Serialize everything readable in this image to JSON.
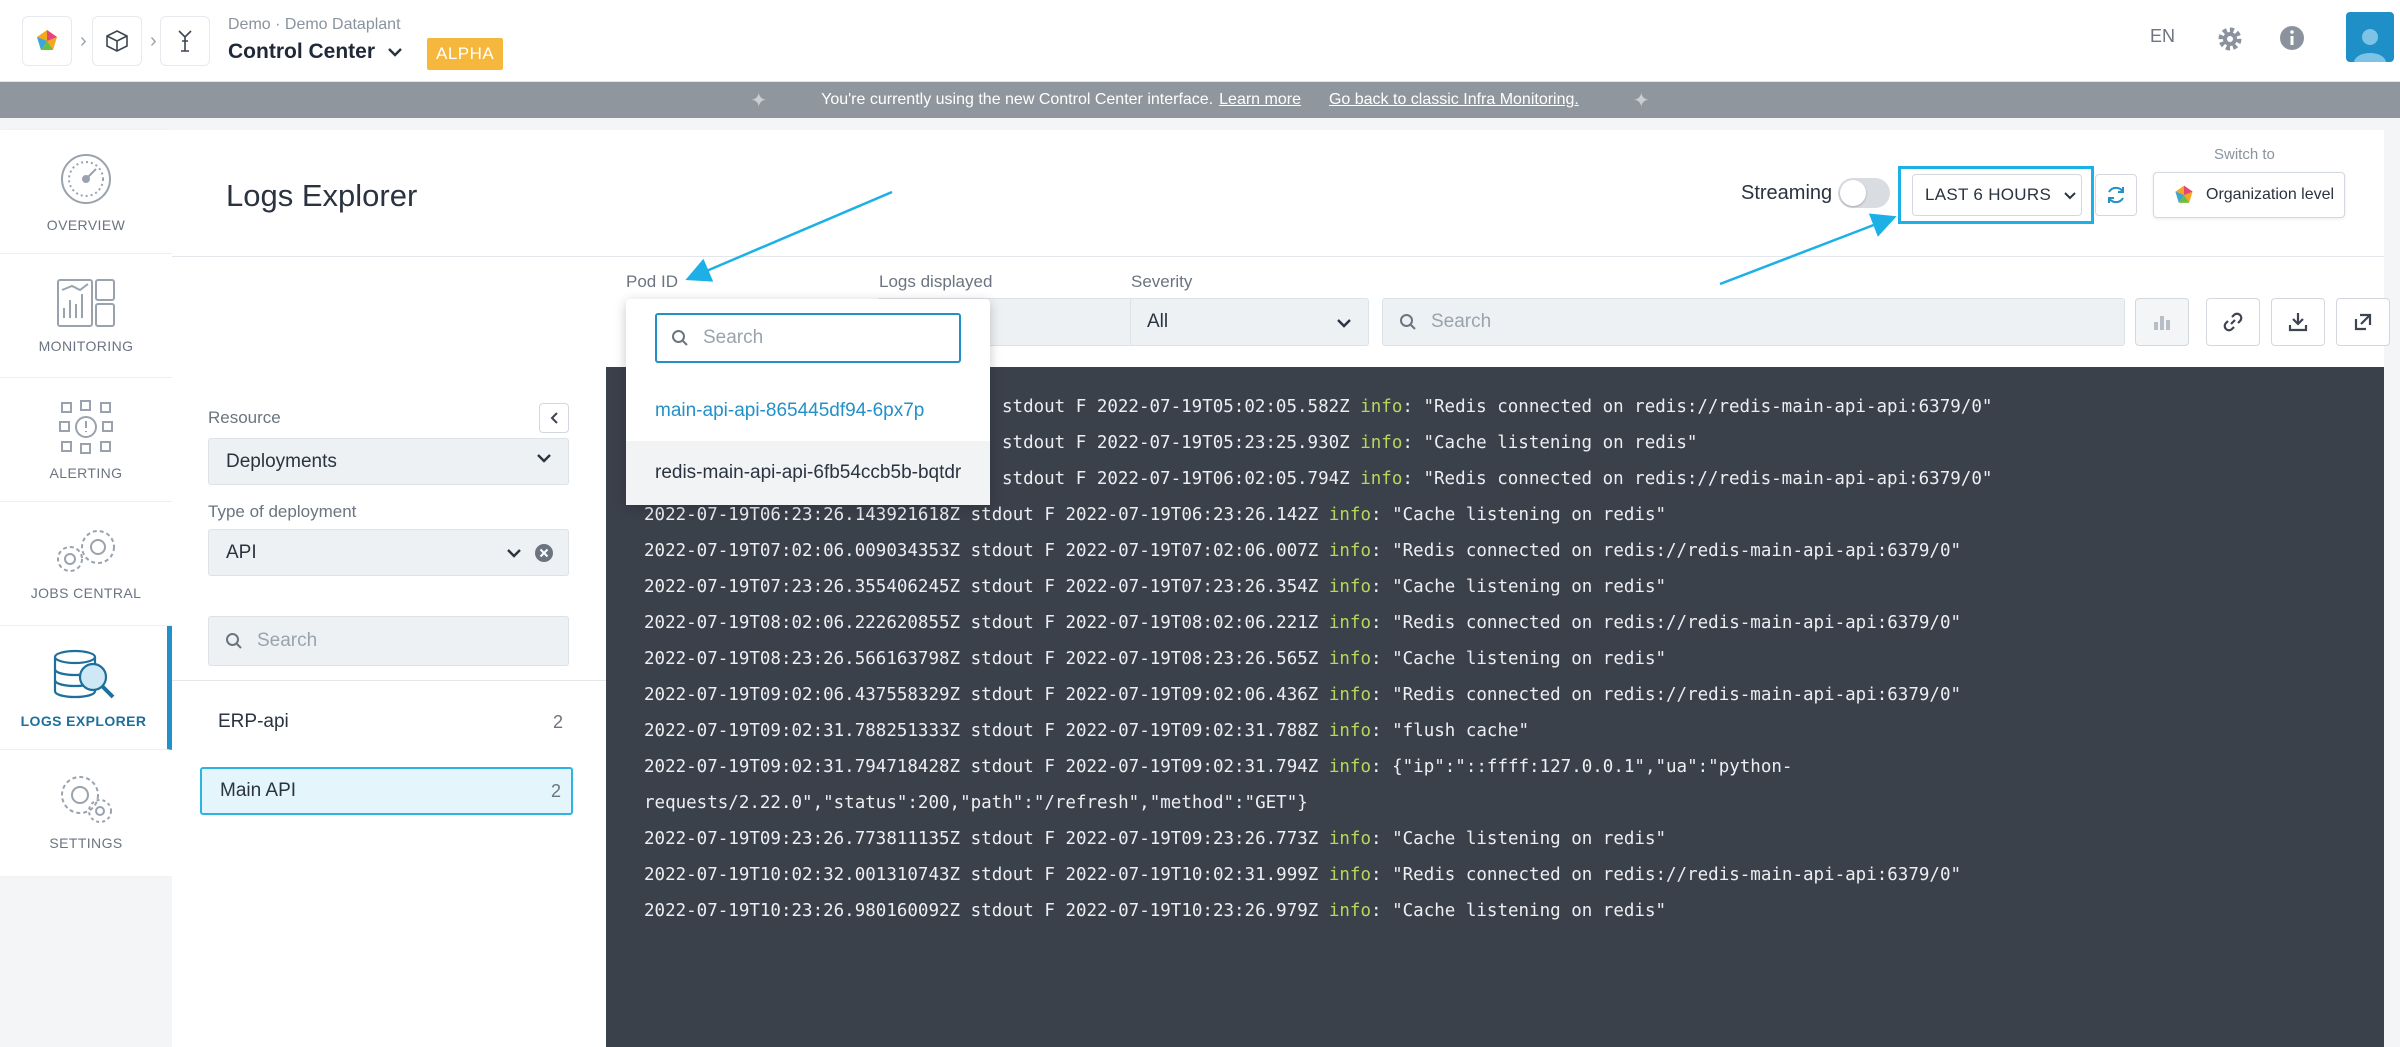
{
  "header": {
    "org_subtitle": "Demo · Demo Dataplant",
    "org_title": "Control Center",
    "alpha_badge": "ALPHA",
    "language": "EN"
  },
  "banner": {
    "message": "You're currently using the new Control Center interface.",
    "learn_more": "Learn more",
    "classic_link": "Go back to classic Infra Monitoring."
  },
  "nav": {
    "items": [
      {
        "label": "OVERVIEW",
        "icon": "gauge-icon"
      },
      {
        "label": "MONITORING",
        "icon": "dashboard-icon"
      },
      {
        "label": "ALERTING",
        "icon": "alert-grid-icon"
      },
      {
        "label": "JOBS CENTRAL",
        "icon": "gears-icon"
      },
      {
        "label": "LOGS EXPLORER",
        "icon": "database-search-icon"
      },
      {
        "label": "SETTINGS",
        "icon": "settings-gears-icon"
      }
    ],
    "active": "LOGS EXPLORER"
  },
  "page": {
    "title": "Logs Explorer",
    "streaming_label": "Streaming",
    "time_range": "LAST 6 HOURS",
    "switch_to_label": "Switch to",
    "org_level_button": "Organization level"
  },
  "resource_panel": {
    "resource_label": "Resource",
    "resource_value": "Deployments",
    "deployment_type_label": "Type of deployment",
    "deployment_type_value": "API",
    "search_placeholder": "Search",
    "deployments": [
      {
        "name": "ERP-api",
        "count": "2"
      },
      {
        "name": "Main API",
        "count": "2"
      }
    ]
  },
  "filters": {
    "pod_id_label": "Pod ID",
    "logs_displayed_label": "Logs displayed",
    "severity_label": "Severity",
    "severity_value": "All",
    "search_placeholder": "Search"
  },
  "pod_dropdown": {
    "search_placeholder": "Search",
    "options": [
      "main-api-api-865445df94-6px7p",
      "redis-main-api-api-6fb54ccb5b-bqtdr"
    ]
  },
  "logs": [
    {
      "prefix": "",
      "text": "stdout F 2022-07-19T05:02:05.582Z ",
      "severity": "info",
      "message": ": \"Redis connected on redis://redis-main-api-api:6379/0\""
    },
    {
      "prefix": "",
      "text": "stdout F 2022-07-19T05:23:25.930Z ",
      "severity": "info",
      "message": ": \"Cache listening on redis\""
    },
    {
      "prefix": "",
      "text": "stdout F 2022-07-19T06:02:05.794Z ",
      "severity": "info",
      "message": ": \"Redis connected on redis://redis-main-api-api:6379/0\""
    },
    {
      "prefix": "2022-07-19T06:23:26.143921618Z ",
      "text": "stdout F 2022-07-19T06:23:26.142Z ",
      "severity": "info",
      "message": ": \"Cache listening on redis\""
    },
    {
      "prefix": "2022-07-19T07:02:06.009034353Z ",
      "text": "stdout F 2022-07-19T07:02:06.007Z ",
      "severity": "info",
      "message": ": \"Redis connected on redis://redis-main-api-api:6379/0\""
    },
    {
      "prefix": "2022-07-19T07:23:26.355406245Z ",
      "text": "stdout F 2022-07-19T07:23:26.354Z ",
      "severity": "info",
      "message": ": \"Cache listening on redis\""
    },
    {
      "prefix": "2022-07-19T08:02:06.222620855Z ",
      "text": "stdout F 2022-07-19T08:02:06.221Z ",
      "severity": "info",
      "message": ": \"Redis connected on redis://redis-main-api-api:6379/0\""
    },
    {
      "prefix": "2022-07-19T08:23:26.566163798Z ",
      "text": "stdout F 2022-07-19T08:23:26.565Z ",
      "severity": "info",
      "message": ": \"Cache listening on redis\""
    },
    {
      "prefix": "2022-07-19T09:02:06.437558329Z ",
      "text": "stdout F 2022-07-19T09:02:06.436Z ",
      "severity": "info",
      "message": ": \"Redis connected on redis://redis-main-api-api:6379/0\""
    },
    {
      "prefix": "2022-07-19T09:02:31.788251333Z ",
      "text": "stdout F 2022-07-19T09:02:31.788Z ",
      "severity": "info",
      "message": ": \"flush cache\""
    },
    {
      "prefix": "2022-07-19T09:02:31.794718428Z ",
      "text": "stdout F 2022-07-19T09:02:31.794Z ",
      "severity": "info",
      "message": ": {\"ip\":\"::ffff:127.0.0.1\",\"ua\":\"python-"
    },
    {
      "prefix": "requests/2.22.0\",\"status\":200,\"path\":\"/refresh\",\"method\":\"GET\"}",
      "text": "",
      "severity": "",
      "message": ""
    },
    {
      "prefix": "2022-07-19T09:23:26.773811135Z ",
      "text": "stdout F 2022-07-19T09:23:26.773Z ",
      "severity": "info",
      "message": ": \"Cache listening on redis\""
    },
    {
      "prefix": "2022-07-19T10:02:32.001310743Z ",
      "text": "stdout F 2022-07-19T10:02:31.999Z ",
      "severity": "info",
      "message": ": \"Redis connected on redis://redis-main-api-api:6379/0\""
    },
    {
      "prefix": "2022-07-19T10:23:26.980160092Z ",
      "text": "stdout F 2022-07-19T10:23:26.979Z ",
      "severity": "info",
      "message": ": \"Cache listening on redis\""
    }
  ],
  "colors": {
    "accent": "#2391c9",
    "highlight": "#1db0e6",
    "alpha": "#f5b83d",
    "console_bg": "#3b414b",
    "severity_info": "#b5d85c"
  }
}
